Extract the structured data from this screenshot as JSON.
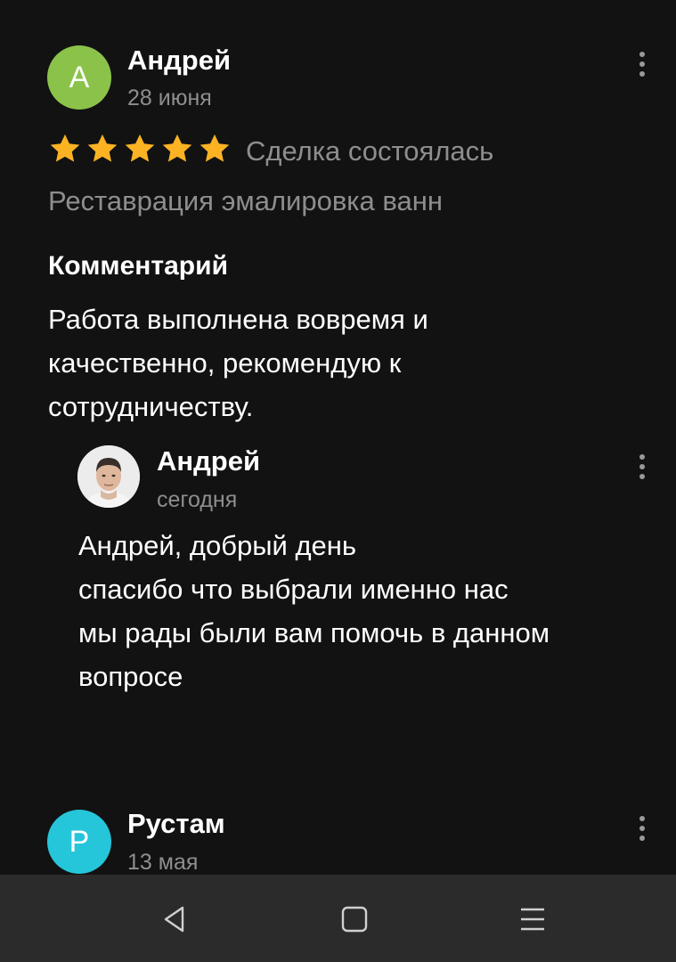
{
  "reviews": [
    {
      "avatar_letter": "А",
      "avatar_color": "#8bc34a",
      "author": "Андрей",
      "date": "28 июня",
      "rating": 5,
      "deal_status": "Сделка состоялась",
      "service": "Реставрация эмалировка ванн",
      "comment_heading": "Комментарий",
      "comment": "Работа выполнена вовремя и качественно, рекомендую к сотрудничеству.",
      "reply": {
        "author": "Андрей",
        "date": "сегодня",
        "text": "Андрей, добрый день\nспасибо что выбрали именно нас\nмы рады были вам помочь в данном вопросе"
      }
    },
    {
      "avatar_letter": "Р",
      "avatar_color": "#26c6da",
      "author": "Рустам",
      "date": "13 мая"
    }
  ],
  "colors": {
    "background": "#121212",
    "star": "#fbb324",
    "muted_text": "#8e8e8e",
    "navbar": "#2b2b2b"
  },
  "icons": {
    "more": "kebab-menu-icon",
    "rating": "star-icon",
    "nav_back": "back-triangle-icon",
    "nav_home": "home-square-icon",
    "nav_menu": "menu-lines-icon"
  }
}
